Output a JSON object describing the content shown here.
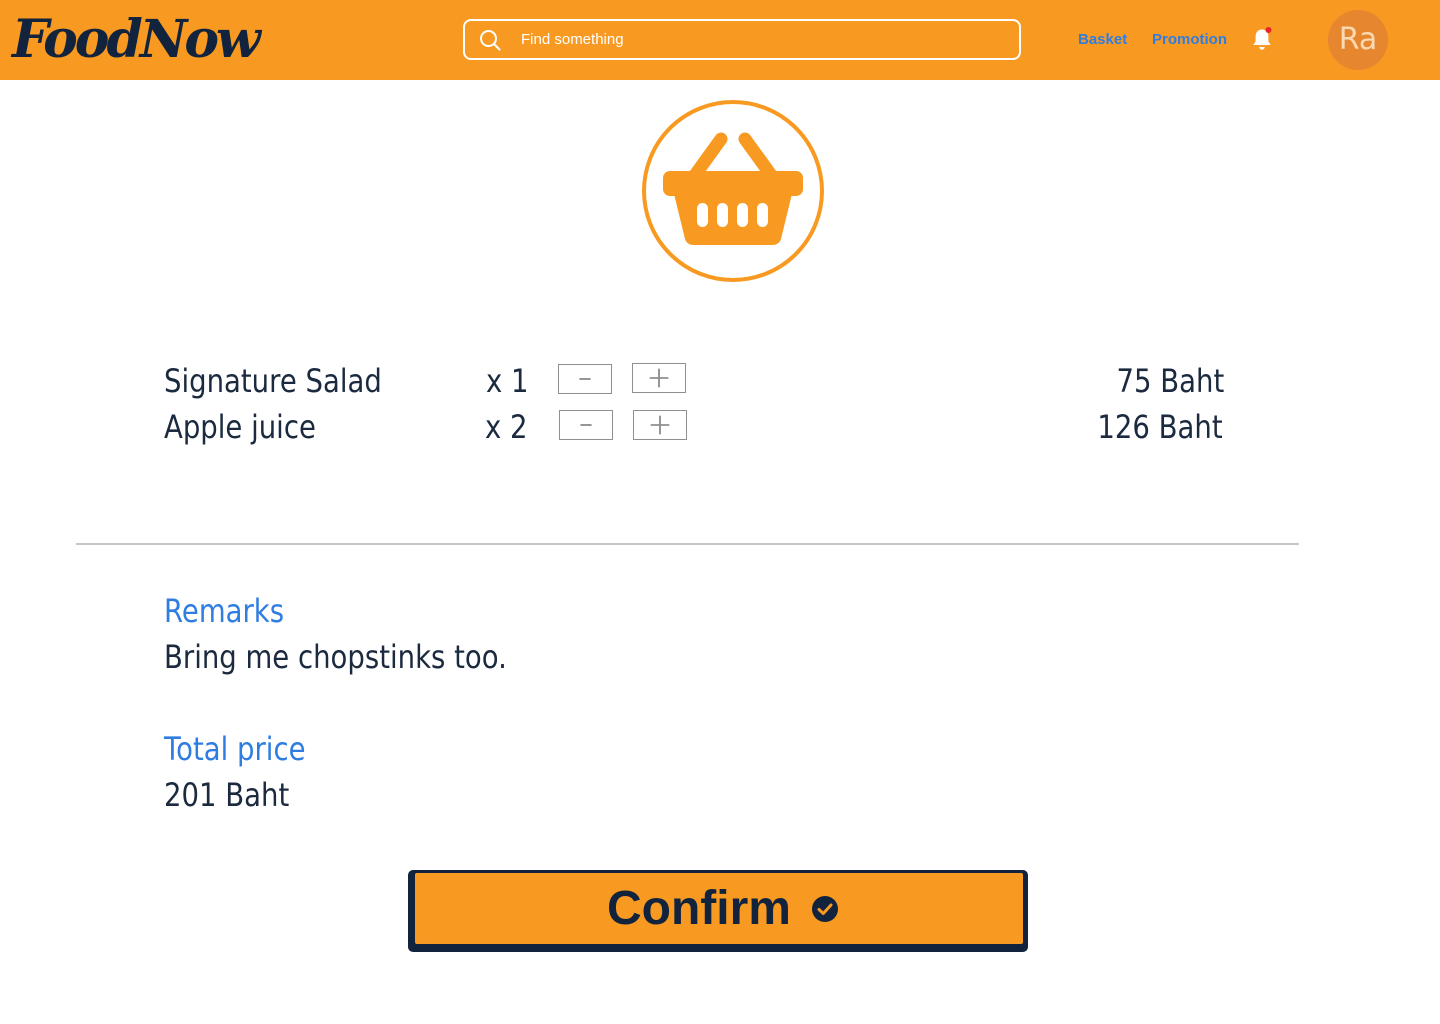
{
  "header": {
    "logo": "FoodNow",
    "search": {
      "placeholder": "Find something",
      "value": ""
    },
    "nav": {
      "basket": "Basket",
      "promotion": "Promotion"
    },
    "notification_icon": "bell-icon",
    "notification_dot_color": "#E8252C",
    "avatar_initials": "Ra",
    "bar_color": "#F89A21"
  },
  "emblem": {
    "icon": "shopping-basket-icon",
    "color": "#F89A21"
  },
  "order": {
    "items": [
      {
        "name": "Signature Salad",
        "quantity": "x 1",
        "price": "75 Baht"
      },
      {
        "name": "Apple juice",
        "quantity": "x 2",
        "price": "126 Baht"
      }
    ],
    "decrement_icon": "minus-icon",
    "increment_icon": "plus-icon"
  },
  "remarks": {
    "label": "Remarks",
    "text": "Bring me chopstinks too."
  },
  "total": {
    "label": "Total price",
    "value": "201 Baht"
  },
  "confirm": {
    "label": "Confirm",
    "icon": "check-circle-icon"
  },
  "colors": {
    "accent": "#F89A21",
    "link": "#2F7DE1",
    "dark": "#12233D",
    "avatar": "#E6862E"
  }
}
